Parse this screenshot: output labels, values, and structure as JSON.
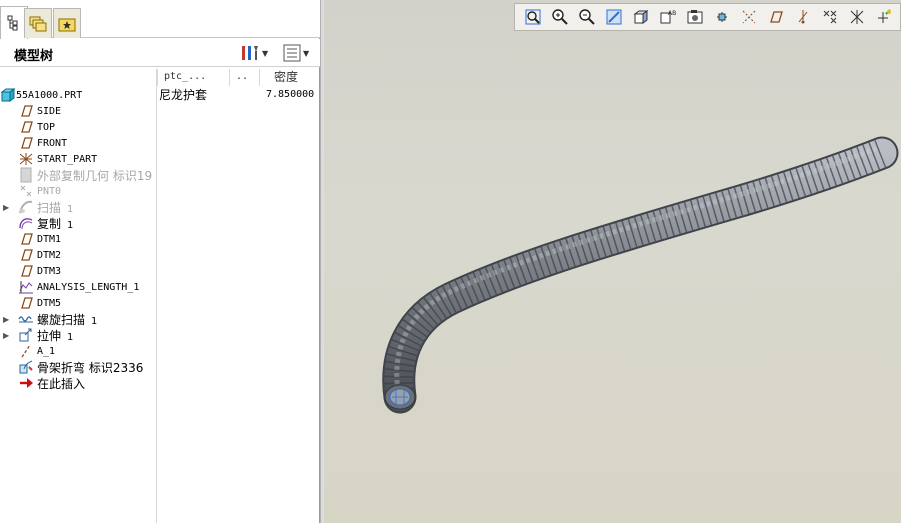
{
  "panel": {
    "title": "模型树",
    "tabs": [
      "model-tree-tab",
      "layers-tab",
      "favorites-tab"
    ]
  },
  "columns": {
    "param": "ptc_...",
    "ellipsis": "..",
    "density": "密度"
  },
  "tree": [
    {
      "label": "55A1000.PRT",
      "icon": "part-icon",
      "cjk": false,
      "dim": false,
      "expander": false,
      "suffix": ""
    },
    {
      "label": "SIDE",
      "icon": "datum-plane-icon",
      "cjk": false,
      "dim": false,
      "expander": false,
      "suffix": ""
    },
    {
      "label": "TOP",
      "icon": "datum-plane-icon",
      "cjk": false,
      "dim": false,
      "expander": false,
      "suffix": ""
    },
    {
      "label": "FRONT",
      "icon": "datum-plane-icon",
      "cjk": false,
      "dim": false,
      "expander": false,
      "suffix": ""
    },
    {
      "label": "START_PART",
      "icon": "coordinate-system-icon",
      "cjk": false,
      "dim": false,
      "expander": false,
      "suffix": ""
    },
    {
      "label": "外部复制几何 标识19",
      "icon": "external-copy-geometry-icon",
      "cjk": true,
      "dim": true,
      "expander": false,
      "suffix": ""
    },
    {
      "label": "PNT0",
      "icon": "datum-point-icon",
      "cjk": false,
      "dim": true,
      "expander": false,
      "suffix": ""
    },
    {
      "label": "扫描",
      "icon": "sweep-icon",
      "cjk": true,
      "dim": true,
      "expander": true,
      "suffix": " 1"
    },
    {
      "label": "复制",
      "icon": "copy-icon",
      "cjk": true,
      "dim": false,
      "expander": false,
      "suffix": " 1"
    },
    {
      "label": "DTM1",
      "icon": "datum-plane-icon",
      "cjk": false,
      "dim": false,
      "expander": false,
      "suffix": ""
    },
    {
      "label": "DTM2",
      "icon": "datum-plane-icon",
      "cjk": false,
      "dim": false,
      "expander": false,
      "suffix": ""
    },
    {
      "label": "DTM3",
      "icon": "datum-plane-icon",
      "cjk": false,
      "dim": false,
      "expander": false,
      "suffix": ""
    },
    {
      "label": "ANALYSIS_LENGTH_1",
      "icon": "analysis-icon",
      "cjk": false,
      "dim": false,
      "expander": false,
      "suffix": ""
    },
    {
      "label": "DTM5",
      "icon": "datum-plane-icon",
      "cjk": false,
      "dim": false,
      "expander": false,
      "suffix": ""
    },
    {
      "label": "螺旋扫描",
      "icon": "helical-sweep-icon",
      "cjk": true,
      "dim": false,
      "expander": true,
      "suffix": " 1"
    },
    {
      "label": "拉伸",
      "icon": "extrude-icon",
      "cjk": true,
      "dim": false,
      "expander": true,
      "suffix": " 1"
    },
    {
      "label": "A_1",
      "icon": "datum-axis-icon",
      "cjk": false,
      "dim": false,
      "expander": false,
      "suffix": ""
    },
    {
      "label": "骨架折弯 标识2336",
      "icon": "spinal-bend-icon",
      "cjk": true,
      "dim": false,
      "expander": false,
      "suffix": ""
    },
    {
      "label": "在此插入",
      "icon": "insert-here-arrow-icon",
      "cjk": true,
      "dim": false,
      "expander": false,
      "suffix": ""
    }
  ],
  "row_values": {
    "param": "尼龙护套",
    "density": "7.850000"
  },
  "toolbar": [
    "refit-icon",
    "zoom-in-icon",
    "zoom-out-icon",
    "repaint-icon",
    "shading-icon",
    "saved-views-icon",
    "view-manager-icon",
    "spin-center-icon",
    "datum-axes-icon",
    "datum-planes-icon",
    "datum-point-display-icon",
    "coordinate-systems-icon",
    "annotations-icon",
    "dimensions-icon"
  ],
  "colors": {
    "viewport_bg": "#d6d5cc",
    "tube": "#7d8389",
    "toolbar_bg": "#f1f0ec",
    "accent_blue": "#2f6fd6",
    "insert_arrow": "#cc1010"
  }
}
